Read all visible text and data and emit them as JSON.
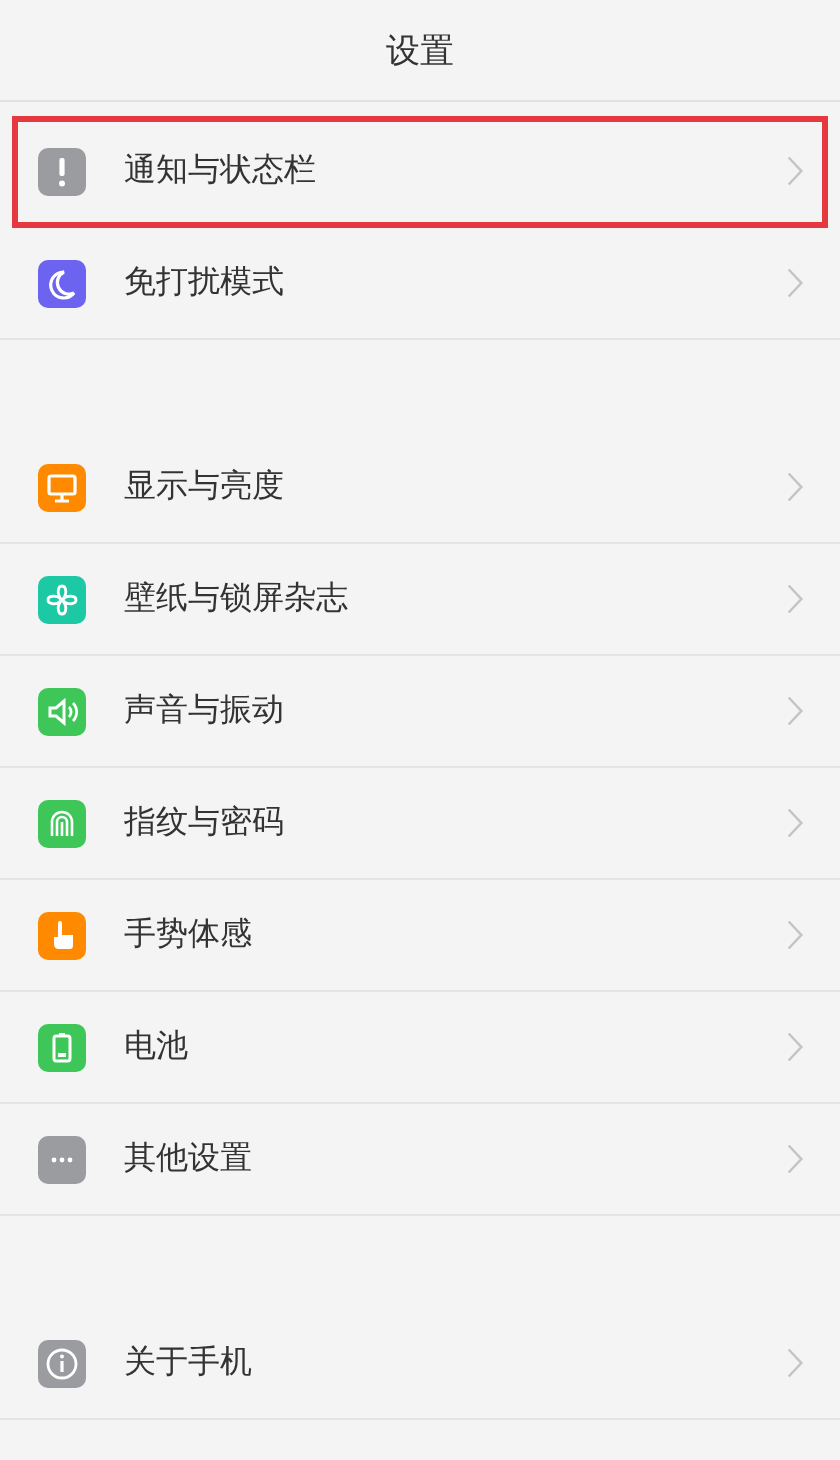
{
  "header": {
    "title": "设置"
  },
  "groups": [
    {
      "items": [
        {
          "label": "通知与状态栏",
          "kind": "notice",
          "color": "#9a9ca0",
          "highlighted": true
        },
        {
          "label": "免打扰模式",
          "kind": "moon",
          "color": "#6c63f0",
          "highlighted": false
        }
      ]
    },
    {
      "items": [
        {
          "label": "显示与亮度",
          "kind": "display",
          "color": "#ff8a00",
          "highlighted": false
        },
        {
          "label": "壁纸与锁屏杂志",
          "kind": "flower",
          "color": "#1cc9a4",
          "highlighted": false
        },
        {
          "label": "声音与振动",
          "kind": "speaker",
          "color": "#3ec659",
          "highlighted": false
        },
        {
          "label": "指纹与密码",
          "kind": "fingerprint",
          "color": "#3ec659",
          "highlighted": false
        },
        {
          "label": "手势体感",
          "kind": "hand",
          "color": "#ff8a00",
          "highlighted": false
        },
        {
          "label": "电池",
          "kind": "battery",
          "color": "#3ec659",
          "highlighted": false
        },
        {
          "label": "其他设置",
          "kind": "more",
          "color": "#9a9ca0",
          "highlighted": false
        }
      ]
    },
    {
      "items": [
        {
          "label": "关于手机",
          "kind": "info",
          "color": "#9a9ca0",
          "highlighted": false
        }
      ]
    }
  ]
}
